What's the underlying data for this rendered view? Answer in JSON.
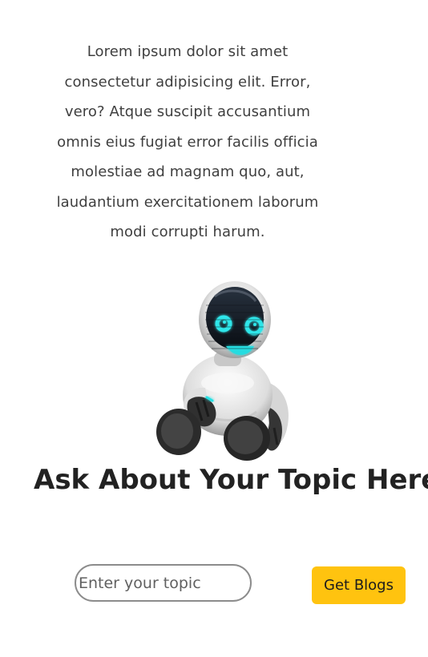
{
  "intro": {
    "text": "Lorem ipsum dolor sit amet consectetur adipisicing elit. Error, vero? Atque suscipit accusantium omnis eius fugiat error facilis officia molestiae ad magnam quo, aut, laudantium exercitationem laborum modi corrupti harum."
  },
  "robot": {
    "icon": "robot-illustration"
  },
  "main": {
    "heading": "Ask About Your Topic Here"
  },
  "search": {
    "placeholder": "Enter your topic",
    "value": "",
    "button_label": "Get Blogs"
  },
  "colors": {
    "button": "#ffc30f",
    "input_border": "#8c8c8c",
    "robot_face": "#20d9df"
  }
}
